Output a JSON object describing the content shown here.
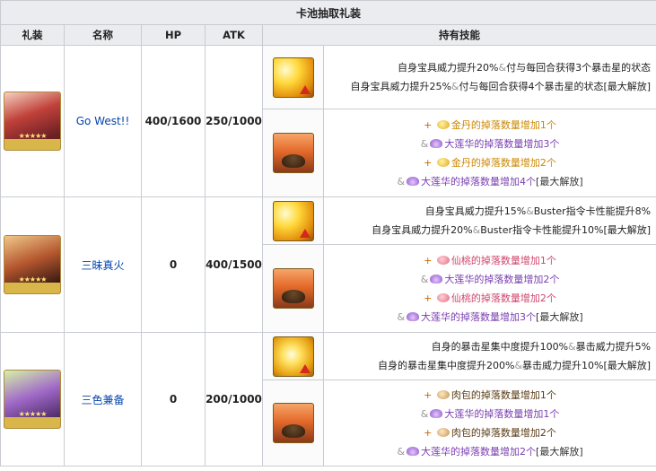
{
  "table": {
    "caption": "卡池抽取礼装",
    "headers": [
      "礼装",
      "名称",
      "HP",
      "ATK",
      "持有技能"
    ]
  },
  "colors": {
    "header_bg": "#eaecf0",
    "link": "#0645ad",
    "border": "#c8ccd1"
  },
  "rows": [
    {
      "name": "Go West!!",
      "hp": "400/1600",
      "atk": "250/1000",
      "skill1": {
        "icon": "np-power-up-icon",
        "line1": {
          "a": "自身宝具威力提升20%",
          "amp": "&",
          "b": "付与每回合获得3个暴击星的状态"
        },
        "line2": {
          "a": "自身宝具威力提升25%",
          "amp": "&",
          "b": "付与每回合获得4个暴击星的状态[最大解放]"
        }
      },
      "skill2": {
        "icon": "drop-bag-icon",
        "lines": [
          {
            "prefix": "+",
            "item": "金丹的掉落数量增加1个",
            "color": "orange",
            "item_icon": "gold-pill-icon"
          },
          {
            "prefix": "&",
            "item": "大莲华的掉落数量增加3个",
            "color": "purple",
            "item_icon": "lotus-icon"
          },
          {
            "prefix": "+",
            "item": "金丹的掉落数量增加2个",
            "color": "orange",
            "item_icon": "gold-pill-icon"
          },
          {
            "prefix": "&",
            "item": "大莲华的掉落数量增加4个",
            "color": "purple",
            "item_icon": "lotus-icon",
            "suffix": "[最大解放]"
          }
        ]
      }
    },
    {
      "name": "三昧真火",
      "hp": "0",
      "atk": "400/1500",
      "skill1": {
        "icon": "np-power-up-icon",
        "line1": {
          "a": "自身宝具威力提升15%",
          "amp": "&",
          "b": "Buster指令卡性能提升8%"
        },
        "line2": {
          "a": "自身宝具威力提升20%",
          "amp": "&",
          "b": "Buster指令卡性能提升10%[最大解放]"
        }
      },
      "skill2": {
        "icon": "drop-bag-icon",
        "lines": [
          {
            "prefix": "+",
            "item": "仙桃的掉落数量增加1个",
            "color": "pink",
            "item_icon": "peach-icon"
          },
          {
            "prefix": "&",
            "item": "大莲华的掉落数量增加2个",
            "color": "purple",
            "item_icon": "lotus-icon"
          },
          {
            "prefix": "+",
            "item": "仙桃的掉落数量增加2个",
            "color": "pink",
            "item_icon": "peach-icon"
          },
          {
            "prefix": "&",
            "item": "大莲华的掉落数量增加3个",
            "color": "purple",
            "item_icon": "lotus-icon",
            "suffix": "[最大解放]"
          }
        ]
      }
    },
    {
      "name": "三色兼备",
      "hp": "0",
      "atk": "200/1000",
      "skill1": {
        "icon": "star-gather-up-icon",
        "line1": {
          "a": "自身的暴击星集中度提升100%",
          "amp": "&",
          "b": "暴击威力提升5%"
        },
        "line2": {
          "a": "自身的暴击星集中度提升200%",
          "amp": "&",
          "b": "暴击威力提升10%[最大解放]"
        }
      },
      "skill2": {
        "icon": "drop-bag-icon",
        "lines": [
          {
            "prefix": "+",
            "item": "肉包的掉落数量增加1个",
            "color": "brown",
            "item_icon": "meat-bun-icon"
          },
          {
            "prefix": "&",
            "item": "大莲华的掉落数量增加1个",
            "color": "purple",
            "item_icon": "lotus-icon"
          },
          {
            "prefix": "+",
            "item": "肉包的掉落数量增加2个",
            "color": "brown",
            "item_icon": "meat-bun-icon"
          },
          {
            "prefix": "&",
            "item": "大莲华的掉落数量增加2个",
            "color": "purple",
            "item_icon": "lotus-icon",
            "suffix": "[最大解放]"
          }
        ]
      }
    }
  ]
}
